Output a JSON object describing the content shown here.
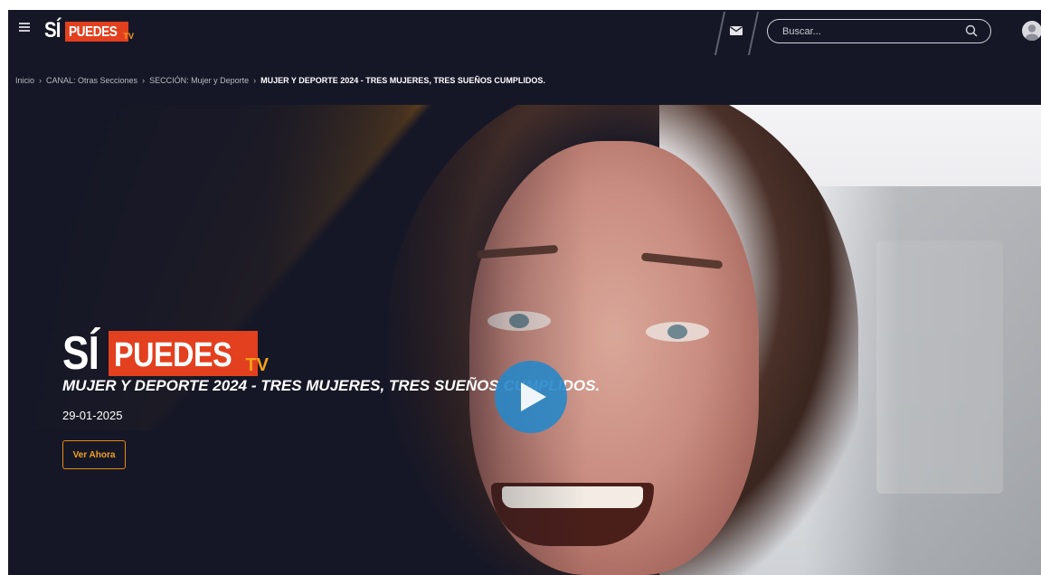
{
  "header": {
    "logo": {
      "si": "SÍ",
      "puedes": "PUEDES",
      "tv": "TV"
    },
    "search": {
      "placeholder": "Buscar..."
    },
    "icons": {
      "menu": "hamburger-menu-icon",
      "mail": "envelope-icon",
      "search": "magnifier-icon",
      "user": "user-avatar-icon"
    }
  },
  "breadcrumb": {
    "items": [
      "Inicio",
      "CANAL: Otras Secciones",
      "SECCIÓN: Mujer y Deporte"
    ],
    "current": "MUJER Y DEPORTE 2024 - TRES MUJERES, TRES SUEÑOS CUMPLIDOS.",
    "separator": "›"
  },
  "hero": {
    "logo": {
      "si": "SÍ",
      "puedes": "PUEDES",
      "tv": "TV"
    },
    "title": "MUJER Y DEPORTE 2024 - TRES MUJERES, TRES SUEÑOS CUMPLIDOS.",
    "date": "29-01-2025",
    "cta_label": "Ver Ahora",
    "play_icon": "play-icon"
  },
  "colors": {
    "background": "#161726",
    "logo_red": "#e2401f",
    "logo_orange": "#f6a11a",
    "cta_orange": "#e58a12",
    "play_blue": "#2887c8"
  }
}
